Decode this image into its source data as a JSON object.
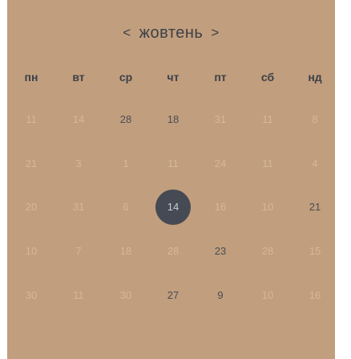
{
  "header": {
    "prev": "<",
    "month": "жовтень",
    "next": ">"
  },
  "weekdays": [
    "пн",
    "вт",
    "ср",
    "чт",
    "пт",
    "сб",
    "нд"
  ],
  "rows": [
    [
      "11",
      "14",
      "28",
      "18",
      "31",
      "11",
      "8"
    ],
    [
      "21",
      "3",
      "1",
      "11",
      "24",
      "11",
      "4"
    ],
    [
      "20",
      "31",
      "6",
      "14",
      "16",
      "10",
      "21"
    ],
    [
      "10",
      "7",
      "18",
      "28",
      "23",
      "28",
      "15"
    ],
    [
      "30",
      "11",
      "30",
      "27",
      "9",
      "10",
      "16"
    ]
  ],
  "selected_day": "14",
  "colors": {
    "background": "#c19e7d",
    "text": "#3c4048",
    "muted": "#d6b89b",
    "selected": "#454a54"
  }
}
